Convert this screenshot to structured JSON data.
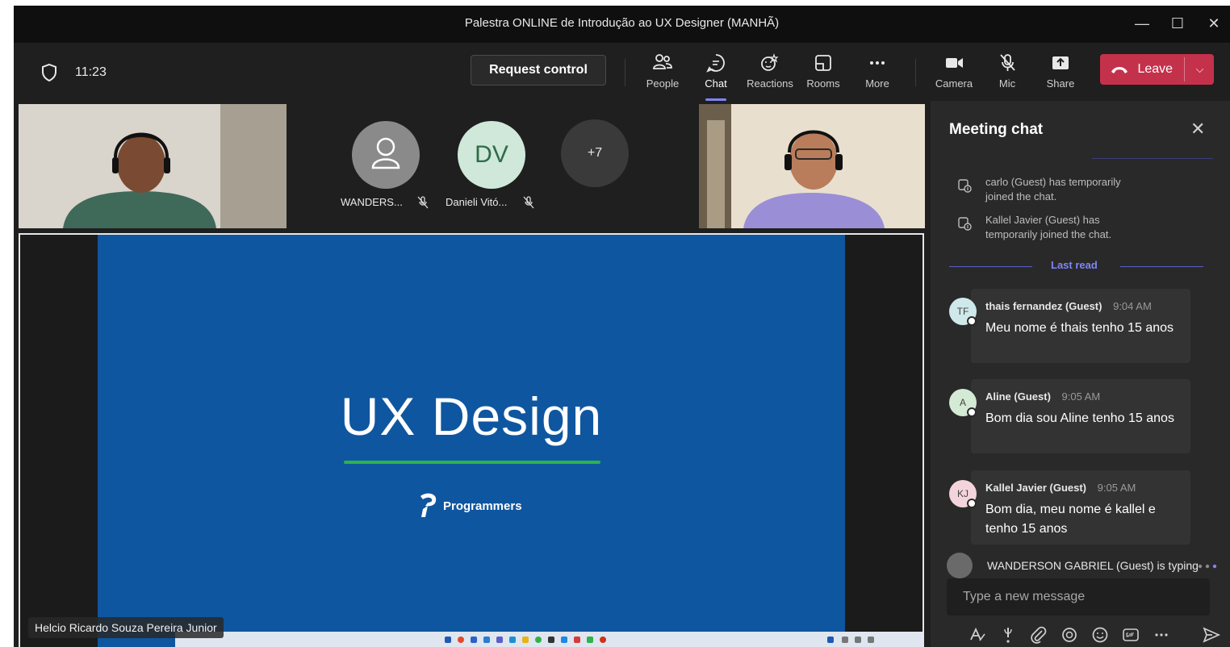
{
  "window": {
    "title": "Palestra ONLINE de Introdução ao UX Designer (MANHÃ)"
  },
  "toolbar": {
    "clock": "11:23",
    "request_control": "Request control",
    "tools": {
      "people": "People",
      "chat": "Chat",
      "reactions": "Reactions",
      "rooms": "Rooms",
      "more": "More",
      "camera": "Camera",
      "mic": "Mic",
      "share": "Share"
    },
    "leave": "Leave"
  },
  "participants": {
    "p1": {
      "name": "WANDERS..."
    },
    "p2": {
      "initials": "DV",
      "name": "Danieli Vitó..."
    },
    "overflow": "+7"
  },
  "stage": {
    "slide_title": "UX Design",
    "brand": "Programmers",
    "presenter": "Helcio Ricardo Souza Pereira Junior"
  },
  "chat": {
    "title": "Meeting chat",
    "system_messages": [
      "carlo (Guest) has temporarily joined the chat.",
      "Kallel Javier (Guest) has temporarily joined the chat."
    ],
    "last_read": "Last read",
    "messages": [
      {
        "initials": "TF",
        "author": "thais fernandez (Guest)",
        "time": "9:04 AM",
        "text": "Meu nome é thais tenho 15 anos"
      },
      {
        "initials": "A",
        "author": "Aline (Guest)",
        "time": "9:05 AM",
        "text": "Bom dia sou Aline tenho 15 anos"
      },
      {
        "initials": "KJ",
        "author": "Kallel Javier (Guest)",
        "time": "9:05 AM",
        "text": "Bom dia, meu nome é kallel e tenho 15 anos"
      }
    ],
    "typing": "WANDERSON GABRIEL (Guest) is typing",
    "compose_placeholder": "Type a new message"
  },
  "colors": {
    "accent": "#7f85f5",
    "leave": "#c4314b",
    "slide_bg": "#0f56a0",
    "slide_rule": "#2db34a"
  }
}
